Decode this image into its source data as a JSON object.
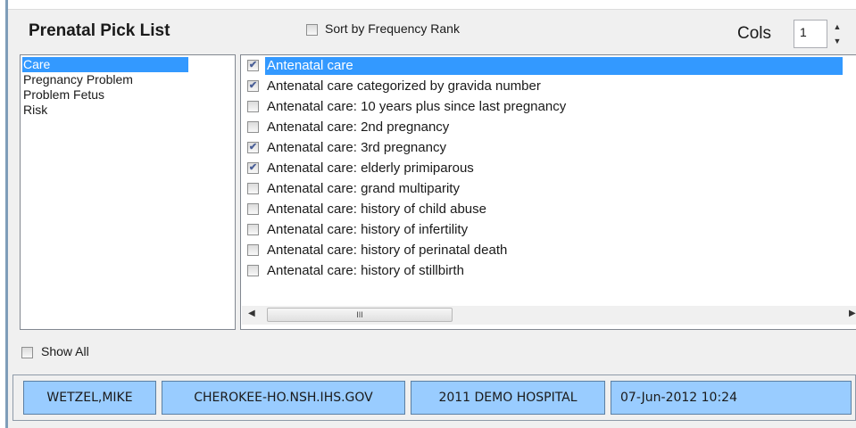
{
  "title": "Prenatal Pick List",
  "sort_by_frequency": {
    "label": "Sort by Frequency Rank",
    "checked": false
  },
  "cols": {
    "label": "Cols",
    "value": "1"
  },
  "categories": [
    {
      "label": "Care",
      "selected": true
    },
    {
      "label": "Pregnancy Problem",
      "selected": false
    },
    {
      "label": "Problem Fetus",
      "selected": false
    },
    {
      "label": "Risk",
      "selected": false
    }
  ],
  "items": [
    {
      "label": "Antenatal care",
      "checked": true,
      "selected": true
    },
    {
      "label": "Antenatal care categorized by gravida number",
      "checked": true,
      "selected": false
    },
    {
      "label": "Antenatal care: 10 years plus since last pregnancy",
      "checked": false,
      "selected": false
    },
    {
      "label": "Antenatal care: 2nd pregnancy",
      "checked": false,
      "selected": false
    },
    {
      "label": "Antenatal care: 3rd pregnancy",
      "checked": true,
      "selected": false
    },
    {
      "label": "Antenatal care: elderly primiparous",
      "checked": true,
      "selected": false
    },
    {
      "label": "Antenatal care: grand multiparity",
      "checked": false,
      "selected": false
    },
    {
      "label": "Antenatal care: history of child abuse",
      "checked": false,
      "selected": false
    },
    {
      "label": "Antenatal care: history of infertility",
      "checked": false,
      "selected": false
    },
    {
      "label": "Antenatal care: history of perinatal death",
      "checked": false,
      "selected": false
    },
    {
      "label": "Antenatal care: history of stillbirth",
      "checked": false,
      "selected": false
    }
  ],
  "scrollbar": {
    "thumb_grip": "III",
    "left_arrow": "◀",
    "right_arrow": "▶"
  },
  "show_all": {
    "label": "Show All",
    "checked": false
  },
  "status": {
    "user": "WETZEL,MIKE",
    "server": "CHEROKEE-HO.NSH.IHS.GOV",
    "facility": "2011 DEMO HOSPITAL",
    "datetime": "07-Jun-2012 10:24"
  },
  "colors": {
    "selection": "#3399ff",
    "status_panel": "#99ccff",
    "form_background": "#f0f0f0"
  }
}
